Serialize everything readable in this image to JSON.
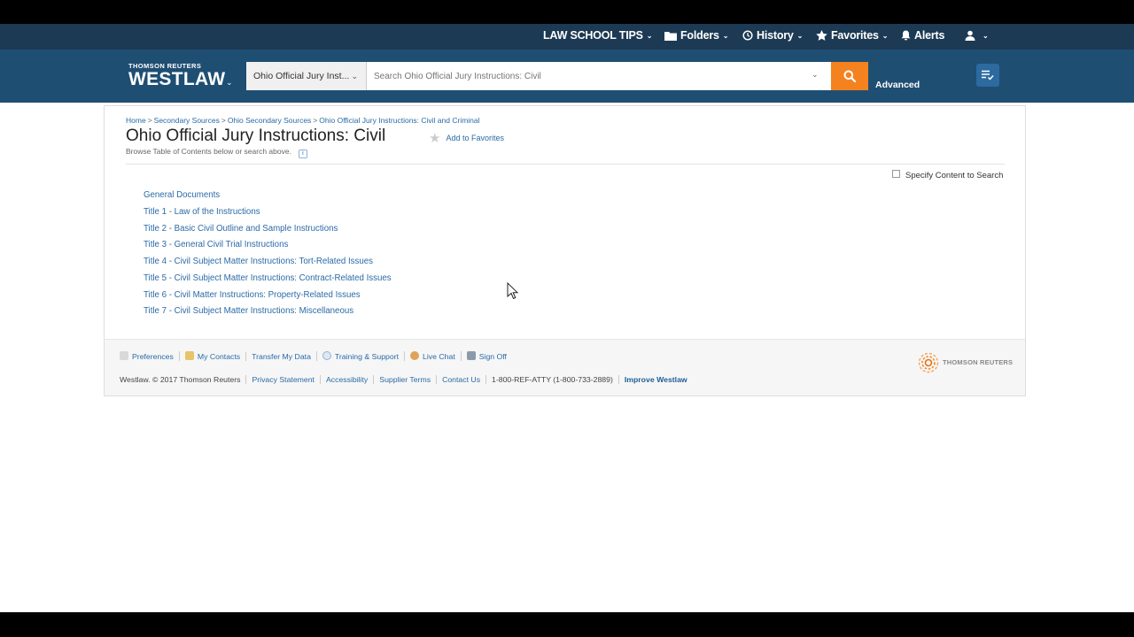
{
  "topbar": {
    "law_school_tips": "LAW SCHOOL TIPS",
    "folders": "Folders",
    "history": "History",
    "favorites": "Favorites",
    "alerts": "Alerts"
  },
  "header": {
    "brand_small": "THOMSON REUTERS",
    "brand_big": "WESTLAW",
    "scope_label": "Ohio Official Jury Inst...",
    "search_placeholder": "Search Ohio Official Jury Instructions: Civil",
    "advanced": "Advanced"
  },
  "breadcrumb": {
    "home": "Home",
    "secondary": "Secondary Sources",
    "ohio_secondary": "Ohio Secondary Sources",
    "current_parent": "Ohio Official Jury Instructions: Civil and Criminal",
    "separator": ">"
  },
  "page": {
    "title": "Ohio Official Jury Instructions: Civil",
    "add_favorites": "Add to Favorites",
    "subtitle": "Browse Table of Contents below or search above.",
    "specify_content": "Specify Content to Search"
  },
  "toc": [
    "General Documents",
    "Title 1 - Law of the Instructions",
    "Title 2 - Basic Civil Outline and Sample Instructions",
    "Title 3 - General Civil Trial Instructions",
    "Title 4 - Civil Subject Matter Instructions: Tort-Related Issues",
    "Title 5 - Civil Subject Matter Instructions: Contract-Related Issues",
    "Title 6 - Civil Matter Instructions: Property-Related Issues",
    "Title 7 - Civil Subject Matter Instructions: Miscellaneous"
  ],
  "footer": {
    "links": [
      "Preferences",
      "My Contacts",
      "Transfer My Data",
      "Training & Support",
      "Live Chat",
      "Sign Off"
    ],
    "copyright": "Westlaw. © 2017 Thomson Reuters",
    "privacy": "Privacy Statement",
    "accessibility": "Accessibility",
    "supplier": "Supplier Terms",
    "contact": "Contact Us",
    "phone": "1-800-REF-ATTY (1-800-733-2889)",
    "improve": "Improve Westlaw",
    "logo_text": "THOMSON REUTERS"
  },
  "colors": {
    "topbar_bg": "#1d3a54",
    "header_bg": "#1f4e73",
    "search_button": "#f4821f",
    "link": "#2a6aa6"
  },
  "icons": [
    "folder-icon",
    "history-icon",
    "star-icon",
    "bell-icon",
    "user-icon",
    "search-icon",
    "list-check-icon"
  ]
}
